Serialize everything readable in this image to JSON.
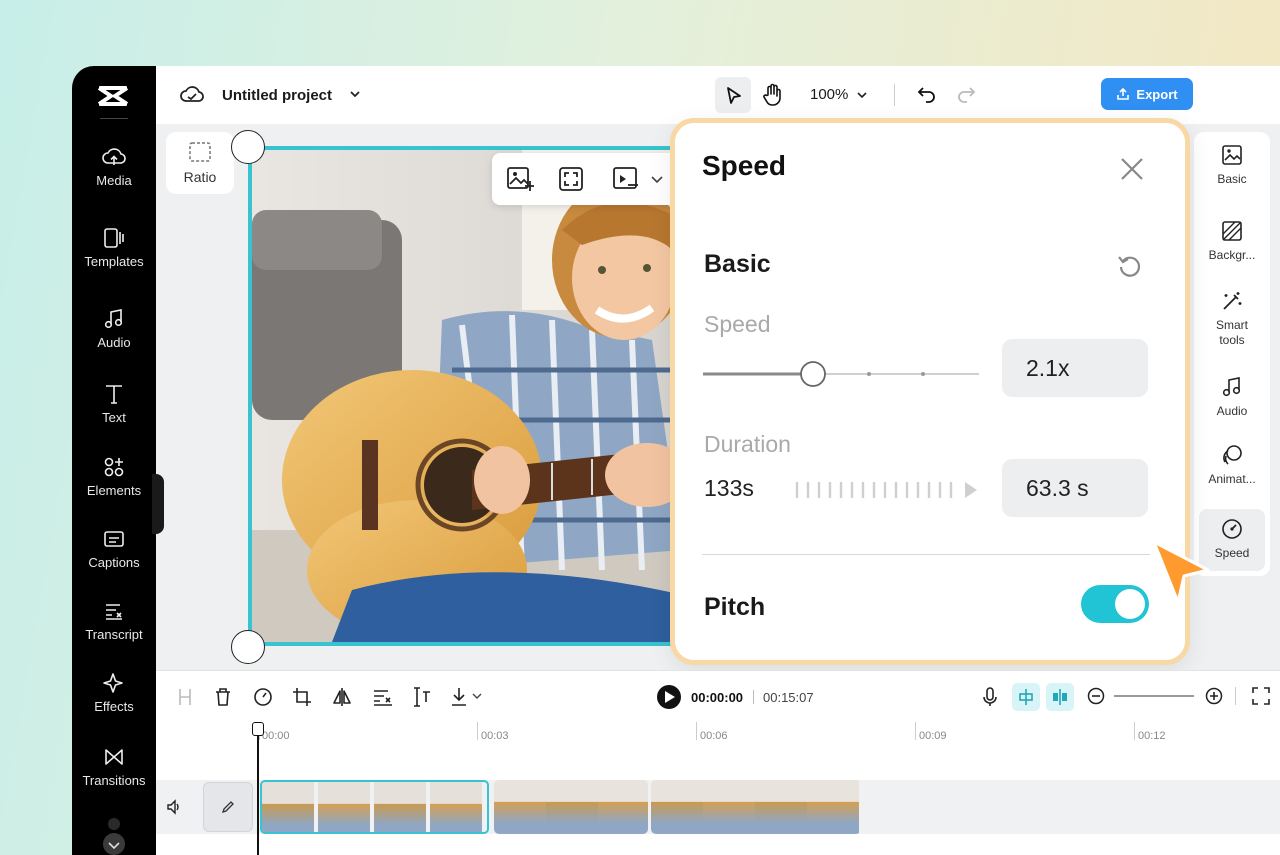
{
  "header": {
    "project_name": "Untitled project",
    "zoom_level": "100%",
    "export_label": "Export"
  },
  "sidebar": {
    "items": [
      {
        "label": "Media",
        "icon": "cloud-upload-icon"
      },
      {
        "label": "Templates",
        "icon": "template-icon"
      },
      {
        "label": "Audio",
        "icon": "music-note-icon"
      },
      {
        "label": "Text",
        "icon": "text-icon"
      },
      {
        "label": "Elements",
        "icon": "shapes-icon"
      },
      {
        "label": "Captions",
        "icon": "captions-icon"
      },
      {
        "label": "Transcript",
        "icon": "transcript-icon"
      },
      {
        "label": "Effects",
        "icon": "sparkle-icon"
      },
      {
        "label": "Transitions",
        "icon": "bowtie-icon"
      }
    ]
  },
  "canvas": {
    "ratio_label": "Ratio"
  },
  "speed_panel": {
    "title": "Speed",
    "section_basic": "Basic",
    "speed_label": "Speed",
    "speed_value": "2.1x",
    "speed_slider_fraction": 0.4,
    "duration_label": "Duration",
    "duration_original": "133s",
    "duration_value": "63.3 s",
    "pitch_label": "Pitch",
    "pitch_enabled": true
  },
  "right_panel": {
    "items": [
      {
        "label": "Basic",
        "icon": "image-adjust-icon"
      },
      {
        "label": "Backgr...",
        "icon": "background-icon"
      },
      {
        "label": "Smart tools",
        "icon": "magic-wand-icon"
      },
      {
        "label": "Audio",
        "icon": "music-note-icon"
      },
      {
        "label": "Animat...",
        "icon": "animation-icon"
      },
      {
        "label": "Speed",
        "icon": "speedometer-icon",
        "active": true
      }
    ]
  },
  "timeline": {
    "current_time": "00:00:00",
    "total_time": "00:15:07",
    "ticks": [
      "00:00",
      "00:03",
      "00:06",
      "00:09",
      "00:12"
    ]
  },
  "colors": {
    "accent": "#20c4d4",
    "export_blue": "#2f8ff3",
    "panel_border": "#f8d8a4",
    "cursor_orange": "#ff9a2e"
  }
}
